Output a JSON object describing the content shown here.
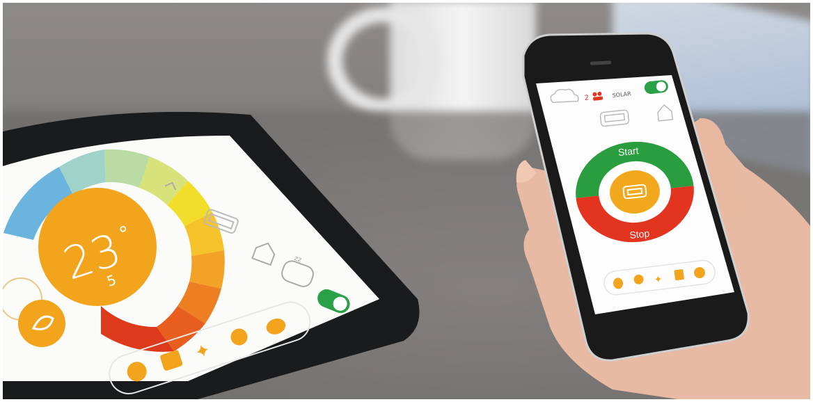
{
  "tablet": {
    "temperature_main": "23",
    "temperature_decimal": "5",
    "temperature_unit": "°",
    "icons": [
      "home-icon",
      "sofa-icon",
      "house-outline-icon",
      "sheep-sleep-icon",
      "power-toggle-icon",
      "leaf-icon"
    ],
    "bottom_bar_icons": [
      "fan-icon",
      "radiator-icon",
      "sparkle-icon",
      "bulb-icon",
      "hand-icon"
    ]
  },
  "phone": {
    "status": {
      "count": "2",
      "label": "SOLAR"
    },
    "start_label": "Start",
    "stop_label": "Stop",
    "colors": {
      "start": "#2a9d3f",
      "stop": "#e2341f",
      "center": "#f1a81c",
      "toggle": "#2aa047"
    },
    "bottom_bar_icons": [
      "hand-icon",
      "bulb-icon",
      "sparkle-icon",
      "radiator-icon",
      "fan-icon"
    ]
  }
}
